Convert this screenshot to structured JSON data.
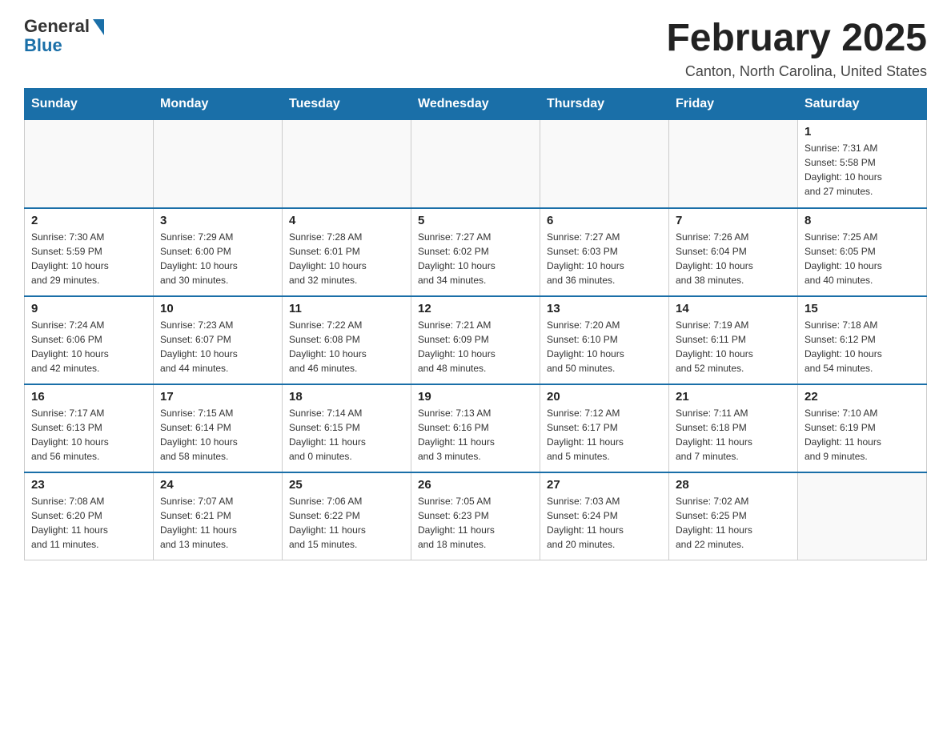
{
  "header": {
    "logo_general": "General",
    "logo_blue": "Blue",
    "month_title": "February 2025",
    "location": "Canton, North Carolina, United States"
  },
  "days_of_week": [
    "Sunday",
    "Monday",
    "Tuesday",
    "Wednesday",
    "Thursday",
    "Friday",
    "Saturday"
  ],
  "weeks": [
    [
      {
        "day": "",
        "info": ""
      },
      {
        "day": "",
        "info": ""
      },
      {
        "day": "",
        "info": ""
      },
      {
        "day": "",
        "info": ""
      },
      {
        "day": "",
        "info": ""
      },
      {
        "day": "",
        "info": ""
      },
      {
        "day": "1",
        "info": "Sunrise: 7:31 AM\nSunset: 5:58 PM\nDaylight: 10 hours\nand 27 minutes."
      }
    ],
    [
      {
        "day": "2",
        "info": "Sunrise: 7:30 AM\nSunset: 5:59 PM\nDaylight: 10 hours\nand 29 minutes."
      },
      {
        "day": "3",
        "info": "Sunrise: 7:29 AM\nSunset: 6:00 PM\nDaylight: 10 hours\nand 30 minutes."
      },
      {
        "day": "4",
        "info": "Sunrise: 7:28 AM\nSunset: 6:01 PM\nDaylight: 10 hours\nand 32 minutes."
      },
      {
        "day": "5",
        "info": "Sunrise: 7:27 AM\nSunset: 6:02 PM\nDaylight: 10 hours\nand 34 minutes."
      },
      {
        "day": "6",
        "info": "Sunrise: 7:27 AM\nSunset: 6:03 PM\nDaylight: 10 hours\nand 36 minutes."
      },
      {
        "day": "7",
        "info": "Sunrise: 7:26 AM\nSunset: 6:04 PM\nDaylight: 10 hours\nand 38 minutes."
      },
      {
        "day": "8",
        "info": "Sunrise: 7:25 AM\nSunset: 6:05 PM\nDaylight: 10 hours\nand 40 minutes."
      }
    ],
    [
      {
        "day": "9",
        "info": "Sunrise: 7:24 AM\nSunset: 6:06 PM\nDaylight: 10 hours\nand 42 minutes."
      },
      {
        "day": "10",
        "info": "Sunrise: 7:23 AM\nSunset: 6:07 PM\nDaylight: 10 hours\nand 44 minutes."
      },
      {
        "day": "11",
        "info": "Sunrise: 7:22 AM\nSunset: 6:08 PM\nDaylight: 10 hours\nand 46 minutes."
      },
      {
        "day": "12",
        "info": "Sunrise: 7:21 AM\nSunset: 6:09 PM\nDaylight: 10 hours\nand 48 minutes."
      },
      {
        "day": "13",
        "info": "Sunrise: 7:20 AM\nSunset: 6:10 PM\nDaylight: 10 hours\nand 50 minutes."
      },
      {
        "day": "14",
        "info": "Sunrise: 7:19 AM\nSunset: 6:11 PM\nDaylight: 10 hours\nand 52 minutes."
      },
      {
        "day": "15",
        "info": "Sunrise: 7:18 AM\nSunset: 6:12 PM\nDaylight: 10 hours\nand 54 minutes."
      }
    ],
    [
      {
        "day": "16",
        "info": "Sunrise: 7:17 AM\nSunset: 6:13 PM\nDaylight: 10 hours\nand 56 minutes."
      },
      {
        "day": "17",
        "info": "Sunrise: 7:15 AM\nSunset: 6:14 PM\nDaylight: 10 hours\nand 58 minutes."
      },
      {
        "day": "18",
        "info": "Sunrise: 7:14 AM\nSunset: 6:15 PM\nDaylight: 11 hours\nand 0 minutes."
      },
      {
        "day": "19",
        "info": "Sunrise: 7:13 AM\nSunset: 6:16 PM\nDaylight: 11 hours\nand 3 minutes."
      },
      {
        "day": "20",
        "info": "Sunrise: 7:12 AM\nSunset: 6:17 PM\nDaylight: 11 hours\nand 5 minutes."
      },
      {
        "day": "21",
        "info": "Sunrise: 7:11 AM\nSunset: 6:18 PM\nDaylight: 11 hours\nand 7 minutes."
      },
      {
        "day": "22",
        "info": "Sunrise: 7:10 AM\nSunset: 6:19 PM\nDaylight: 11 hours\nand 9 minutes."
      }
    ],
    [
      {
        "day": "23",
        "info": "Sunrise: 7:08 AM\nSunset: 6:20 PM\nDaylight: 11 hours\nand 11 minutes."
      },
      {
        "day": "24",
        "info": "Sunrise: 7:07 AM\nSunset: 6:21 PM\nDaylight: 11 hours\nand 13 minutes."
      },
      {
        "day": "25",
        "info": "Sunrise: 7:06 AM\nSunset: 6:22 PM\nDaylight: 11 hours\nand 15 minutes."
      },
      {
        "day": "26",
        "info": "Sunrise: 7:05 AM\nSunset: 6:23 PM\nDaylight: 11 hours\nand 18 minutes."
      },
      {
        "day": "27",
        "info": "Sunrise: 7:03 AM\nSunset: 6:24 PM\nDaylight: 11 hours\nand 20 minutes."
      },
      {
        "day": "28",
        "info": "Sunrise: 7:02 AM\nSunset: 6:25 PM\nDaylight: 11 hours\nand 22 minutes."
      },
      {
        "day": "",
        "info": ""
      }
    ]
  ]
}
